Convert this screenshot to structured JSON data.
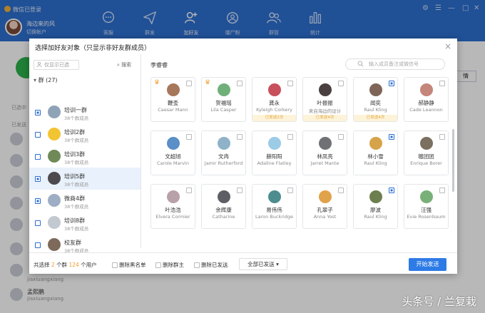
{
  "app": {
    "title": "微信已登录",
    "user_name": "海边来的风",
    "user_sub": "切换帐户"
  },
  "nav": [
    {
      "label": "客服",
      "icon": "chat-bubble-icon"
    },
    {
      "label": "群发",
      "icon": "send-plane-icon"
    },
    {
      "label": "加好友",
      "icon": "add-friend-icon"
    },
    {
      "label": "僵尸粉",
      "icon": "zombie-fans-icon"
    },
    {
      "label": "群管",
      "icon": "group-manage-icon"
    },
    {
      "label": "统计",
      "icon": "bar-chart-icon"
    }
  ],
  "background": {
    "detail_button": "情",
    "section1": "已选中",
    "section2": "已发送",
    "bottom_name": "孟熙鹏",
    "bottom_sub": "jiaxiuangxiang",
    "row_sub": "jiaxiuangxiang"
  },
  "watermark": "头条号 / 兰复栽",
  "dialog": {
    "title": "选择加好友对象（只显示非好友群成员）",
    "close": "×",
    "search_selected": "仅显示已选",
    "search_link": "搜索",
    "group_header": "群 (27)",
    "groups": [
      {
        "name": "培训一群",
        "sub": "38个群成员",
        "checked": true,
        "color": "#8fa3b8"
      },
      {
        "name": "培训2群",
        "sub": "38个群成员",
        "checked": false,
        "color": "#f2c431"
      },
      {
        "name": "培训3群",
        "sub": "38个群成员",
        "checked": false,
        "color": "#6f8a58"
      },
      {
        "name": "培训5群",
        "sub": "38个群成员",
        "checked": true,
        "color": "#4c4a4e"
      },
      {
        "name": "微商4群",
        "sub": "38个群成员",
        "checked": true,
        "color": "#9eaec4"
      },
      {
        "name": "培训8群",
        "sub": "38个群成员",
        "checked": false,
        "color": "#c2c9d1"
      },
      {
        "name": "校友群",
        "sub": "38个群成员",
        "checked": false,
        "color": "#7d6a5b"
      }
    ],
    "current_group": "李睿睿",
    "member_search_placeholder": "输入成员备注或微信号",
    "members": [
      {
        "n1": "鞭歪",
        "n2": "Caesar Mann",
        "checked": false,
        "crown": true,
        "tag": "",
        "color": "#a7775c"
      },
      {
        "n1": "贺福瑶",
        "n2": "Lila Casper",
        "checked": false,
        "crown": true,
        "tag": "",
        "color": "#6fb07a"
      },
      {
        "n1": "龚永",
        "n2": "Kyleigh Corkery",
        "checked": false,
        "crown": false,
        "tag": "已发送2次",
        "color": "#c84f5c"
      },
      {
        "n1": "叶振振",
        "n2": "来自海边的设计",
        "checked": false,
        "crown": false,
        "tag": "已发送4次",
        "color": "#4b4040"
      },
      {
        "n1": "闻奕",
        "n2": "Raul Kling",
        "checked": true,
        "crown": false,
        "tag": "已发送4次",
        "color": "#7f6458"
      },
      {
        "n1": "郝静静",
        "n2": "Cade Leannon",
        "checked": false,
        "crown": false,
        "tag": "",
        "color": "#c4857a"
      },
      {
        "n1": "文超旭",
        "n2": "Carole Marvin",
        "checked": false,
        "crown": false,
        "tag": "",
        "color": "#5a8fc7"
      },
      {
        "n1": "文冉",
        "n2": "Jamir Rutherford",
        "checked": false,
        "crown": false,
        "tag": "",
        "color": "#8fb2c9"
      },
      {
        "n1": "薛阳阳",
        "n2": "Adaline Flatley",
        "checked": false,
        "crown": false,
        "tag": "",
        "color": "#9ccbe6"
      },
      {
        "n1": "林凤亮",
        "n2": "Jarret Mante",
        "checked": false,
        "crown": false,
        "tag": "",
        "color": "#6f7175"
      },
      {
        "n1": "林小雪",
        "n2": "Raul Kling",
        "checked": true,
        "crown": false,
        "tag": "",
        "color": "#d6a34a"
      },
      {
        "n1": "毽团团",
        "n2": "Enrique Borer",
        "checked": false,
        "crown": false,
        "tag": "",
        "color": "#7b6f5f"
      },
      {
        "n1": "叶浩浩",
        "n2": "Elvera Cormier",
        "checked": false,
        "crown": false,
        "tag": "",
        "color": "#b8a1a9"
      },
      {
        "n1": "余辉康",
        "n2": "Catharine",
        "checked": false,
        "crown": false,
        "tag": "",
        "color": "#5c5f63"
      },
      {
        "n1": "易伟伟",
        "n2": "Laron Buckridge",
        "checked": false,
        "crown": false,
        "tag": "",
        "color": "#4d8d8f"
      },
      {
        "n1": "孔翠子",
        "n2": "Anna Yost",
        "checked": false,
        "crown": false,
        "tag": "",
        "color": "#e0a24a"
      },
      {
        "n1": "廖波",
        "n2": "Raul Kling",
        "checked": true,
        "crown": false,
        "tag": "",
        "color": "#6d7f4e"
      },
      {
        "n1": "汪强",
        "n2": "Evie Rosenbaum",
        "checked": false,
        "crown": false,
        "tag": "",
        "color": "#79b079"
      }
    ],
    "footer": {
      "summary_prefix": "共选择",
      "groups_count": "2",
      "summary_mid": "个群",
      "users_count": "124",
      "summary_suffix": "个用户",
      "opt_blacklist": "删除黑名单",
      "opt_owner": "删除群主",
      "opt_sent": "删除已发送",
      "dropdown": "全部已发送",
      "start": "开始发送"
    }
  },
  "colors": {
    "accent": "#2d6fd0",
    "highlight": "#f29b2c",
    "start_button": "#2d7be6"
  }
}
